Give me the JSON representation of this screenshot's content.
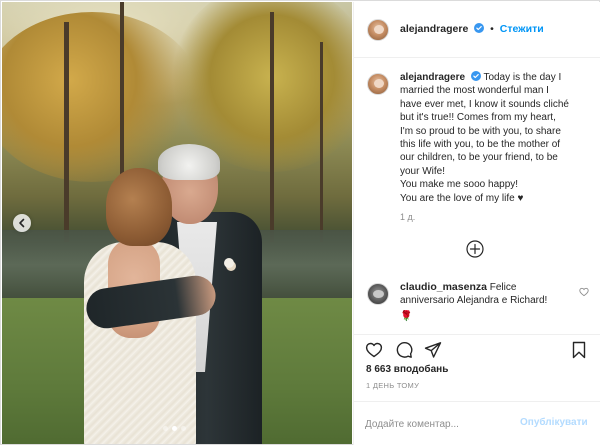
{
  "post": {
    "username": "alejandragere",
    "follow_label": "Стежити",
    "separator": "•",
    "caption_lines": [
      "Today is the day I",
      "married the most wonderful man I",
      "have ever met, I know it sounds cliché",
      "but it's true!! Comes from my heart,",
      "I'm so proud to be with you, to share",
      "this life with you, to be the mother of",
      "our children, to be your friend, to be",
      "your Wife!",
      "You make me sooo happy!",
      "You are the love of my life ♥"
    ],
    "caption_age": "1 д.",
    "comment": {
      "username": "claudio_masenza",
      "text": "Felice anniversario Alejandra e Richard!",
      "emoji": "🌹"
    },
    "likes": "8 663 вподобань",
    "posted_ago": "1 ДЕНЬ ТОМУ",
    "add_comment_placeholder": "Додайте коментар...",
    "publish_label": "Опублікувати",
    "carousel": {
      "slides": 3,
      "active_index": 1
    }
  },
  "colors": {
    "link_blue": "#0095f6",
    "publish_disabled": "#b3dbff",
    "muted": "#8e8e8e",
    "border": "#dbdbdb"
  },
  "icons": [
    "verified-badge-icon",
    "chevron-left-icon",
    "plus-circle-icon",
    "heart-icon",
    "comment-icon",
    "share-icon",
    "bookmark-icon"
  ]
}
